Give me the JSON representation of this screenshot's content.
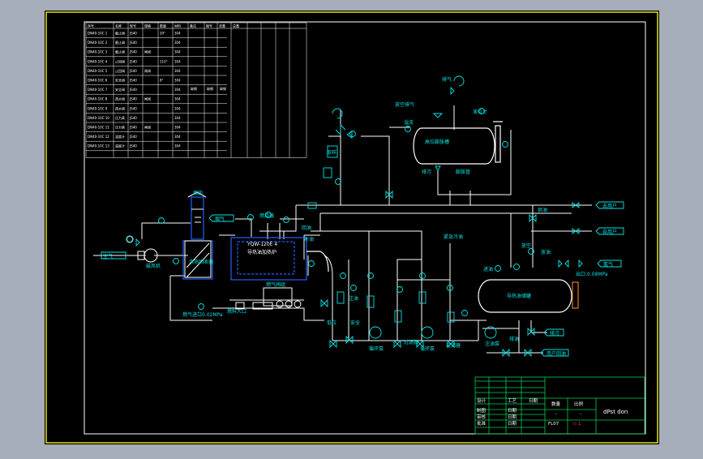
{
  "colors": {
    "background": "#a5aeba",
    "canvas": "#000000",
    "frame": "#ffffff",
    "outer_frame": "#e6e600",
    "line": "#ffffff",
    "label": "#00e5e5",
    "component": "#00e5e5",
    "equipment": "#1e64ff",
    "title_block": "#00d050"
  },
  "schedule": {
    "header_row": [
      "序号",
      "名称",
      "型号",
      "规格",
      "数量",
      "材料",
      "备注",
      "图号",
      "单重",
      "总重",
      "",
      ""
    ],
    "rows": [
      [
        "DN40-10C 1",
        "截止阀",
        "JS40",
        "",
        "20°",
        "304"
      ],
      [
        "DN40-10C 2",
        "截止阀",
        "JS40",
        "",
        "",
        "304"
      ],
      [
        "DN40-10C 3",
        "截止阀",
        "JS40",
        "闸阀",
        "",
        "304"
      ],
      [
        "DN40-10C 4",
        "止回阀",
        "JS40",
        "",
        "110°",
        "304"
      ],
      [
        "DN40-10C 5",
        "止回阀",
        "JS40",
        "闸阀",
        "",
        "304"
      ],
      [
        "DN40-10C 6",
        "安全阀",
        "JS40",
        "",
        "8°",
        "304"
      ],
      [
        "DN40-10C 7",
        "安全阀",
        "JS40",
        "",
        "",
        "304"
      ],
      [
        "DN40-10C 8",
        "疏水阀",
        "JS40",
        "闸阀",
        "",
        "304"
      ],
      [
        "DN40-10C 9",
        "疏水阀",
        "JS40",
        "",
        "",
        "304"
      ],
      [
        "DN40-10C 10",
        "压力表",
        "JS40",
        "",
        "",
        "304"
      ],
      [
        "DN40-10C 11",
        "压力表",
        "JS40",
        "闸阀",
        "",
        "304"
      ],
      [
        "DN40-10C 12",
        "温度计",
        "JS40",
        "",
        "",
        "304"
      ],
      [
        "DN40-10C 13",
        "温度计",
        "JS40",
        "",
        "",
        "304"
      ]
    ],
    "col5": "碳钢",
    "col6": "碳钢",
    "col7": "碳钢"
  },
  "labels": {
    "chimney": "烟囱",
    "heat_recovery": "余热回收器",
    "boiler_line1": "YQW-120E 4",
    "boiler_line2": "导热油加热炉",
    "burner": "燃烧器",
    "expansion_tank": "高位膨胀槽",
    "storage_tank": "导热油储罐",
    "fill_oil": "补油",
    "air": "空气",
    "blower": "鼓风机",
    "flue_gas": "烟气",
    "nitrogen": "氮气",
    "exhaust": "排气",
    "sampling": "取样",
    "drain": "排污",
    "drain2": "排污",
    "gas_train": "燃气阀组",
    "gas_supply": "燃气进口0.02MPa",
    "overflow": "溢流",
    "water_vapor": "放空排气",
    "gas_note": "燃气压力0.02MPa",
    "oil_return": "回油",
    "oil_supply": "供油",
    "to_user": "去用户",
    "from_user": "自用户",
    "user_return": "用户回油",
    "inject": "注油",
    "pump1": "循环泵",
    "pump2": "循环泵",
    "pump3": "注油泵",
    "filter1": "过滤器",
    "filter2": "过滤器",
    "fuel_in": "燃料入口",
    "tank_drain": "排油",
    "oil_out": "放油",
    "vent": "放空",
    "exp_vent_top": "排气",
    "exp_level": "液位计",
    "emerg_cool": "紧急冷油",
    "exp_connect": "膨胀管",
    "line_label": "导热油",
    "p_label": "P",
    "t_label": "T",
    "pi": "PI",
    "ti": "TI",
    "tank_inlet": "进油",
    "low_point": "低位",
    "safety": "安全",
    "note_small": "0.08MPa",
    "note_val": "出口:0.08MPa"
  },
  "title_block": {
    "row1": [
      "设计",
      "",
      "工艺",
      "",
      "日期"
    ],
    "row2": [
      "制图",
      "",
      "日期"
    ],
    "row3": [
      "审核",
      "",
      "日期"
    ],
    "row4": [
      "批准",
      "",
      "日期"
    ],
    "ratio_label": "比例",
    "qty_label": "数量",
    "drawing_name": "dPst don",
    "number": "FL07",
    "sheet": "共1张",
    "misc": "第1张",
    "dash1": "-",
    "dash2": "-",
    "code": "▭ 1"
  }
}
